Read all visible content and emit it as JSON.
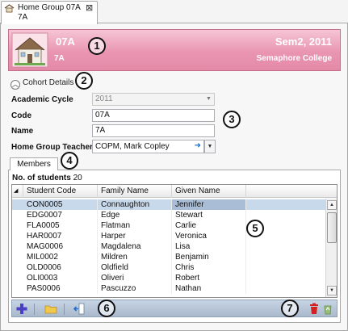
{
  "tab": {
    "title_line1": "Home Group 07A",
    "title_line2": "7A"
  },
  "banner": {
    "code": "07A",
    "subcode": "7A",
    "semester": "Sem2, 2011",
    "school": "Semaphore College"
  },
  "cohort": {
    "label": "Cohort Details"
  },
  "form": {
    "academic_cycle_label": "Academic Cycle",
    "academic_cycle_value": "2011",
    "code_label": "Code",
    "code_value": "07A",
    "name_label": "Name",
    "name_value": "7A",
    "teacher_label": "Home Group Teacher",
    "teacher_value": "COPM, Mark Copley"
  },
  "members": {
    "tab_label": "Members",
    "count_label": "No. of students",
    "count_value": "20",
    "columns": [
      "Student Code",
      "Family Name",
      "Given Name"
    ],
    "rows": [
      [
        "CON0005",
        "Connaughton",
        "Jennifer"
      ],
      [
        "EDG0007",
        "Edge",
        "Stewart"
      ],
      [
        "FLA0005",
        "Flatman",
        "Carlie"
      ],
      [
        "HAR0007",
        "Harper",
        "Veronica"
      ],
      [
        "MAG0006",
        "Magdalena",
        "Lisa"
      ],
      [
        "MIL0002",
        "Mildren",
        "Benjamin"
      ],
      [
        "OLD0006",
        "Oldfield",
        "Chris"
      ],
      [
        "OLI0003",
        "Oliveri",
        "Robert"
      ],
      [
        "PAS0006",
        "Pascuzzo",
        "Nathan"
      ]
    ]
  },
  "markers": [
    "1",
    "2",
    "3",
    "4",
    "5",
    "6",
    "7"
  ],
  "colors": {
    "banner": "#e995b1",
    "selection": "#c8d9ec",
    "toolbar": "#b8c7d8",
    "accent_plus": "#4b3fc4",
    "delete": "#d42020"
  },
  "icons": [
    "home-icon",
    "close-icon",
    "house-icon",
    "chevron-up-icon",
    "dropdown-arrow-icon",
    "navigate-arrow-icon",
    "add-icon",
    "folder-icon",
    "import-icon",
    "delete-icon",
    "recycle-icon"
  ]
}
